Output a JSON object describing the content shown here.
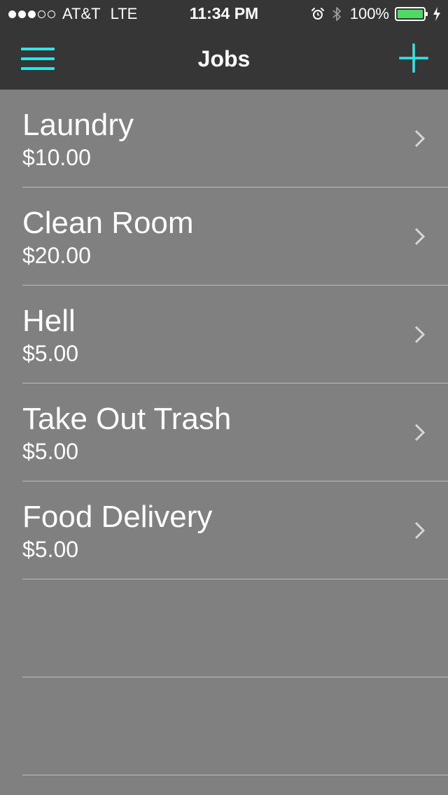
{
  "status_bar": {
    "signal_dots": "●●●○○",
    "carrier": "AT&T",
    "network": "LTE",
    "time": "11:34 PM",
    "battery_percent": "100%",
    "icons": [
      "alarm-icon",
      "bluetooth-icon",
      "battery-icon",
      "charging-icon"
    ]
  },
  "nav": {
    "title": "Jobs",
    "menu_icon": "hamburger-menu-icon",
    "add_icon": "plus-icon"
  },
  "jobs": [
    {
      "name": "Laundry",
      "price": "$10.00"
    },
    {
      "name": "Clean Room",
      "price": "$20.00"
    },
    {
      "name": "Hell",
      "price": "$5.00"
    },
    {
      "name": "Take Out Trash",
      "price": "$5.00"
    },
    {
      "name": "Food Delivery",
      "price": "$5.00"
    }
  ],
  "colors": {
    "accent": "#2fe6e6",
    "nav_background": "#363636",
    "list_background": "#808080",
    "separator": "#bdbdbd",
    "battery_fill": "#4cd964"
  }
}
